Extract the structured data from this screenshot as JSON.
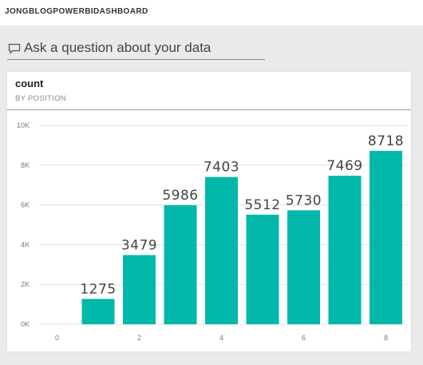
{
  "dashboard": {
    "title": "JONGBLOGPOWERBIDASHBOARD"
  },
  "qna": {
    "prompt": "Ask a question about your data",
    "icon": "chat-bubble-icon"
  },
  "tile": {
    "title": "count",
    "subtitle": "BY POSITION"
  },
  "colors": {
    "bar": "#01b8aa",
    "gridline": "#e3e3e3",
    "background": "#eaeaea"
  },
  "chart_data": {
    "type": "bar",
    "x": [
      1,
      2,
      3,
      4,
      5,
      6,
      7,
      8
    ],
    "values": [
      1275,
      3479,
      5986,
      7403,
      5512,
      5730,
      7469,
      8718
    ],
    "data_labels": [
      "1275",
      "3479",
      "5986",
      "7403",
      "5512",
      "5730",
      "7469",
      "8718"
    ],
    "xlim": [
      0,
      8
    ],
    "x_ticks": [
      0,
      2,
      4,
      6,
      8
    ],
    "x_tick_labels": [
      "0",
      "2",
      "4",
      "6",
      "8"
    ],
    "ylim": [
      0,
      10000
    ],
    "y_ticks": [
      0,
      2000,
      4000,
      6000,
      8000,
      10000
    ],
    "y_tick_labels": [
      "0K",
      "2K",
      "4K",
      "6K",
      "8K",
      "10K"
    ],
    "grid": true,
    "legend": "none"
  }
}
